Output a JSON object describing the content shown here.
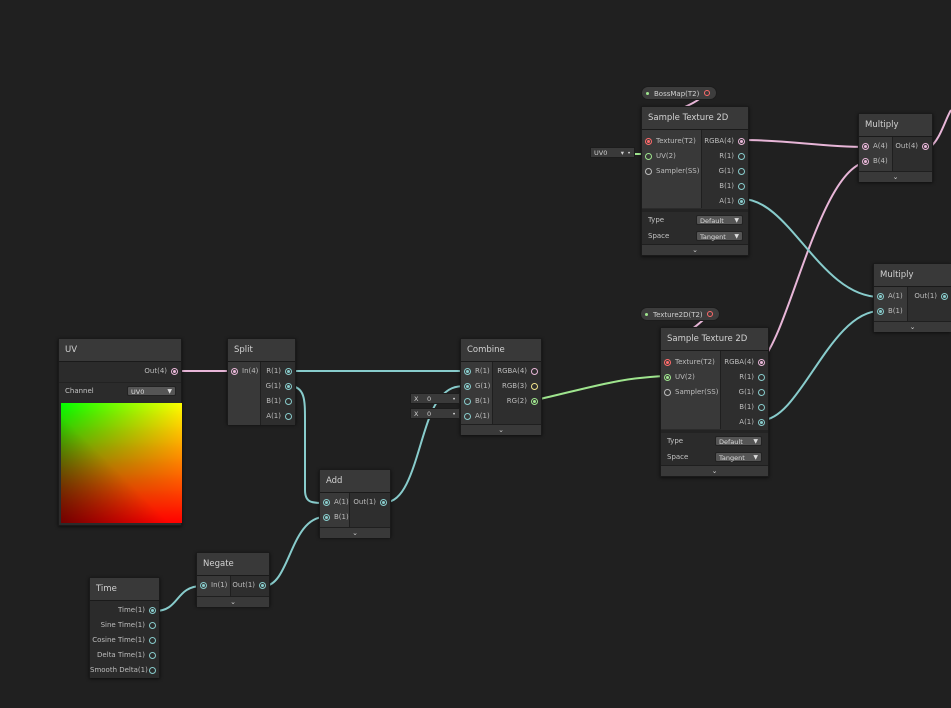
{
  "uv_node": {
    "title": "UV",
    "out": "Out(4)",
    "channel_label": "Channel",
    "channel_value": "UV0"
  },
  "split_node": {
    "title": "Split",
    "in": "In(4)",
    "outs": [
      "R(1)",
      "G(1)",
      "B(1)",
      "A(1)"
    ]
  },
  "combine_node": {
    "title": "Combine",
    "ins": [
      "R(1)",
      "G(1)",
      "B(1)",
      "A(1)"
    ],
    "outs": [
      "RGBA(4)",
      "RGB(3)",
      "RG(2)"
    ],
    "b_field": {
      "axis": "X",
      "value": "0"
    },
    "a_field": {
      "axis": "X",
      "value": "0"
    }
  },
  "add_node": {
    "title": "Add",
    "ins": [
      "A(1)",
      "B(1)"
    ],
    "out": "Out(1)"
  },
  "negate_node": {
    "title": "Negate",
    "in": "In(1)",
    "out": "Out(1)"
  },
  "time_node": {
    "title": "Time",
    "outs": [
      "Time(1)",
      "Sine Time(1)",
      "Cosine Time(1)",
      "Delta Time(1)",
      "Smooth Delta(1)"
    ]
  },
  "sample_top": {
    "title": "Sample Texture 2D",
    "ins": [
      "Texture(T2)",
      "UV(2)",
      "Sampler(SS)"
    ],
    "outs": [
      "RGBA(4)",
      "R(1)",
      "G(1)",
      "B(1)",
      "A(1)"
    ],
    "type_label": "Type",
    "type_value": "Default",
    "space_label": "Space",
    "space_value": "Tangent",
    "uv_field": "UV0",
    "property": "BossMap(T2)"
  },
  "sample_bottom": {
    "title": "Sample Texture 2D",
    "ins": [
      "Texture(T2)",
      "UV(2)",
      "Sampler(SS)"
    ],
    "outs": [
      "RGBA(4)",
      "R(1)",
      "G(1)",
      "B(1)",
      "A(1)"
    ],
    "type_label": "Type",
    "type_value": "Default",
    "space_label": "Space",
    "space_value": "Tangent",
    "property": "Texture2D(T2)"
  },
  "multiply_top": {
    "title": "Multiply",
    "ins": [
      "A(4)",
      "B(4)"
    ],
    "out": "Out(4)"
  },
  "multiply_bottom": {
    "title": "Multiply",
    "ins": [
      "A(1)",
      "B(1)"
    ],
    "out": "Out(1)"
  },
  "icons": {
    "collapse": "chevron-down-icon",
    "dropdown": "triangle-down-icon"
  },
  "colors": {
    "background": "#202020",
    "wire_float": "#88cccc",
    "wire_vector4": "#e8b6d8",
    "wire_vector2": "#9fe58e"
  }
}
